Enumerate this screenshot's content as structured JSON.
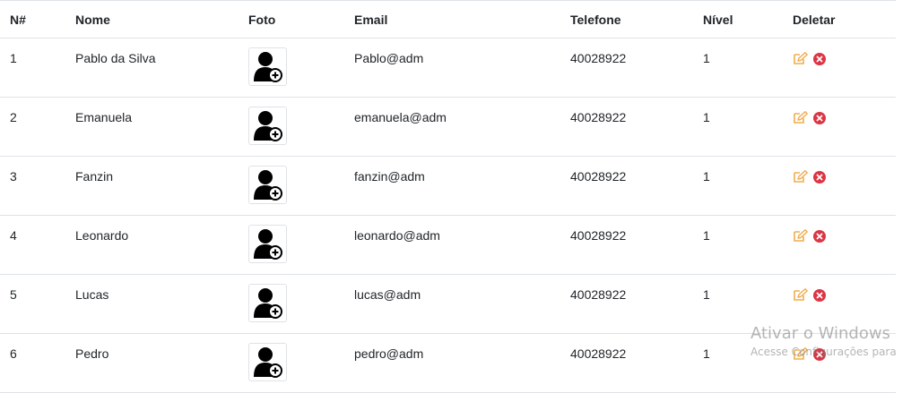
{
  "table": {
    "headers": [
      "N#",
      "Nome",
      "Foto",
      "Email",
      "Telefone",
      "Nível",
      "Deletar"
    ],
    "rows": [
      {
        "id": "1",
        "name": "Pablo da Silva",
        "email": "Pablo@adm",
        "phone": "40028922",
        "level": "1"
      },
      {
        "id": "2",
        "name": "Emanuela",
        "email": "emanuela@adm",
        "phone": "40028922",
        "level": "1"
      },
      {
        "id": "3",
        "name": "Fanzin",
        "email": "fanzin@adm",
        "phone": "40028922",
        "level": "1"
      },
      {
        "id": "4",
        "name": "Leonardo",
        "email": "leonardo@adm",
        "phone": "40028922",
        "level": "1"
      },
      {
        "id": "5",
        "name": "Lucas",
        "email": "lucas@adm",
        "phone": "40028922",
        "level": "1"
      },
      {
        "id": "6",
        "name": "Pedro",
        "email": "pedro@adm",
        "phone": "40028922",
        "level": "1"
      }
    ],
    "photo_icon": "user-plus-icon",
    "edit_icon": "edit-icon",
    "delete_icon": "close-circle-icon"
  },
  "colors": {
    "edit": "#f0ad4e",
    "delete": "#dc3545",
    "border": "#dee2e6"
  },
  "watermark": {
    "title": "Ativar o Windows",
    "subtitle": "Acesse Configurações para"
  }
}
